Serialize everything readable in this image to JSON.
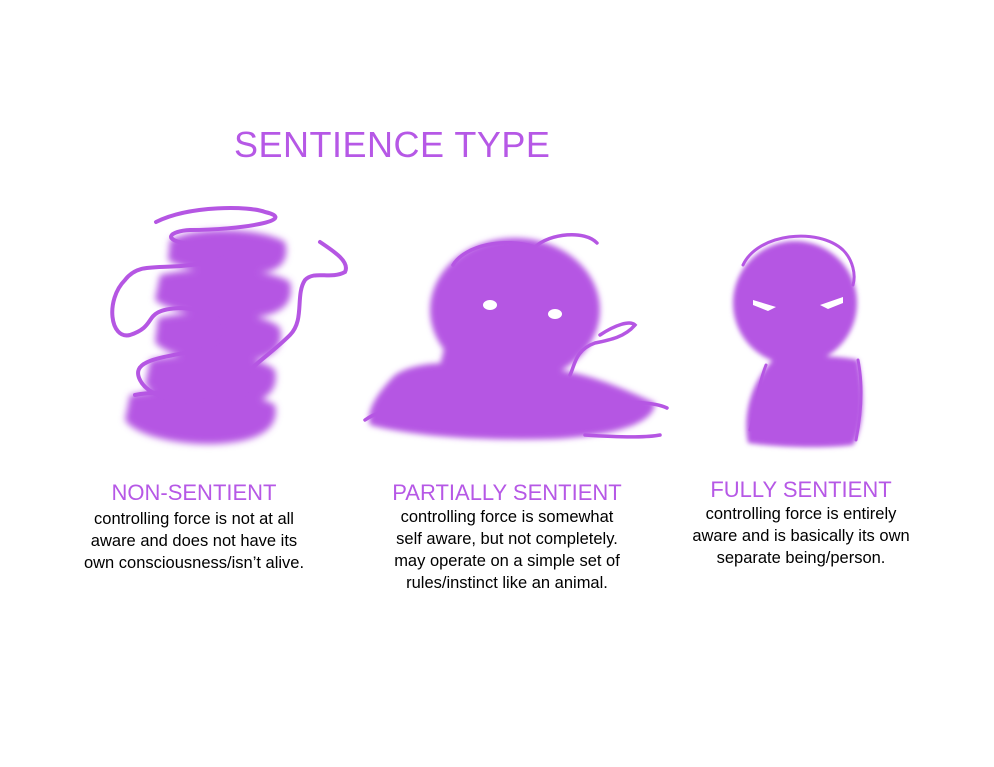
{
  "colors": {
    "accent": "#b658e6",
    "fill": "#b556e3",
    "text": "#000000",
    "background": "#ffffff"
  },
  "title": "SENTIENCE TYPE",
  "types": [
    {
      "heading": "NON-SENTIENT",
      "lines": [
        "controlling force is not at all",
        "aware and does not have its",
        "own consciousness/isn’t alive."
      ],
      "illustration": "swirling-blob"
    },
    {
      "heading": "PARTIALLY SENTIENT",
      "lines": [
        "controlling force is somewhat",
        "self aware, but not completely.",
        "may operate on a simple set of",
        "rules/instinct like an animal."
      ],
      "illustration": "creature-with-eyes"
    },
    {
      "heading": "FULLY SENTIENT",
      "lines": [
        "controlling force is entirely",
        "aware and is basically its own",
        "separate being/person."
      ],
      "illustration": "person-silhouette"
    }
  ]
}
